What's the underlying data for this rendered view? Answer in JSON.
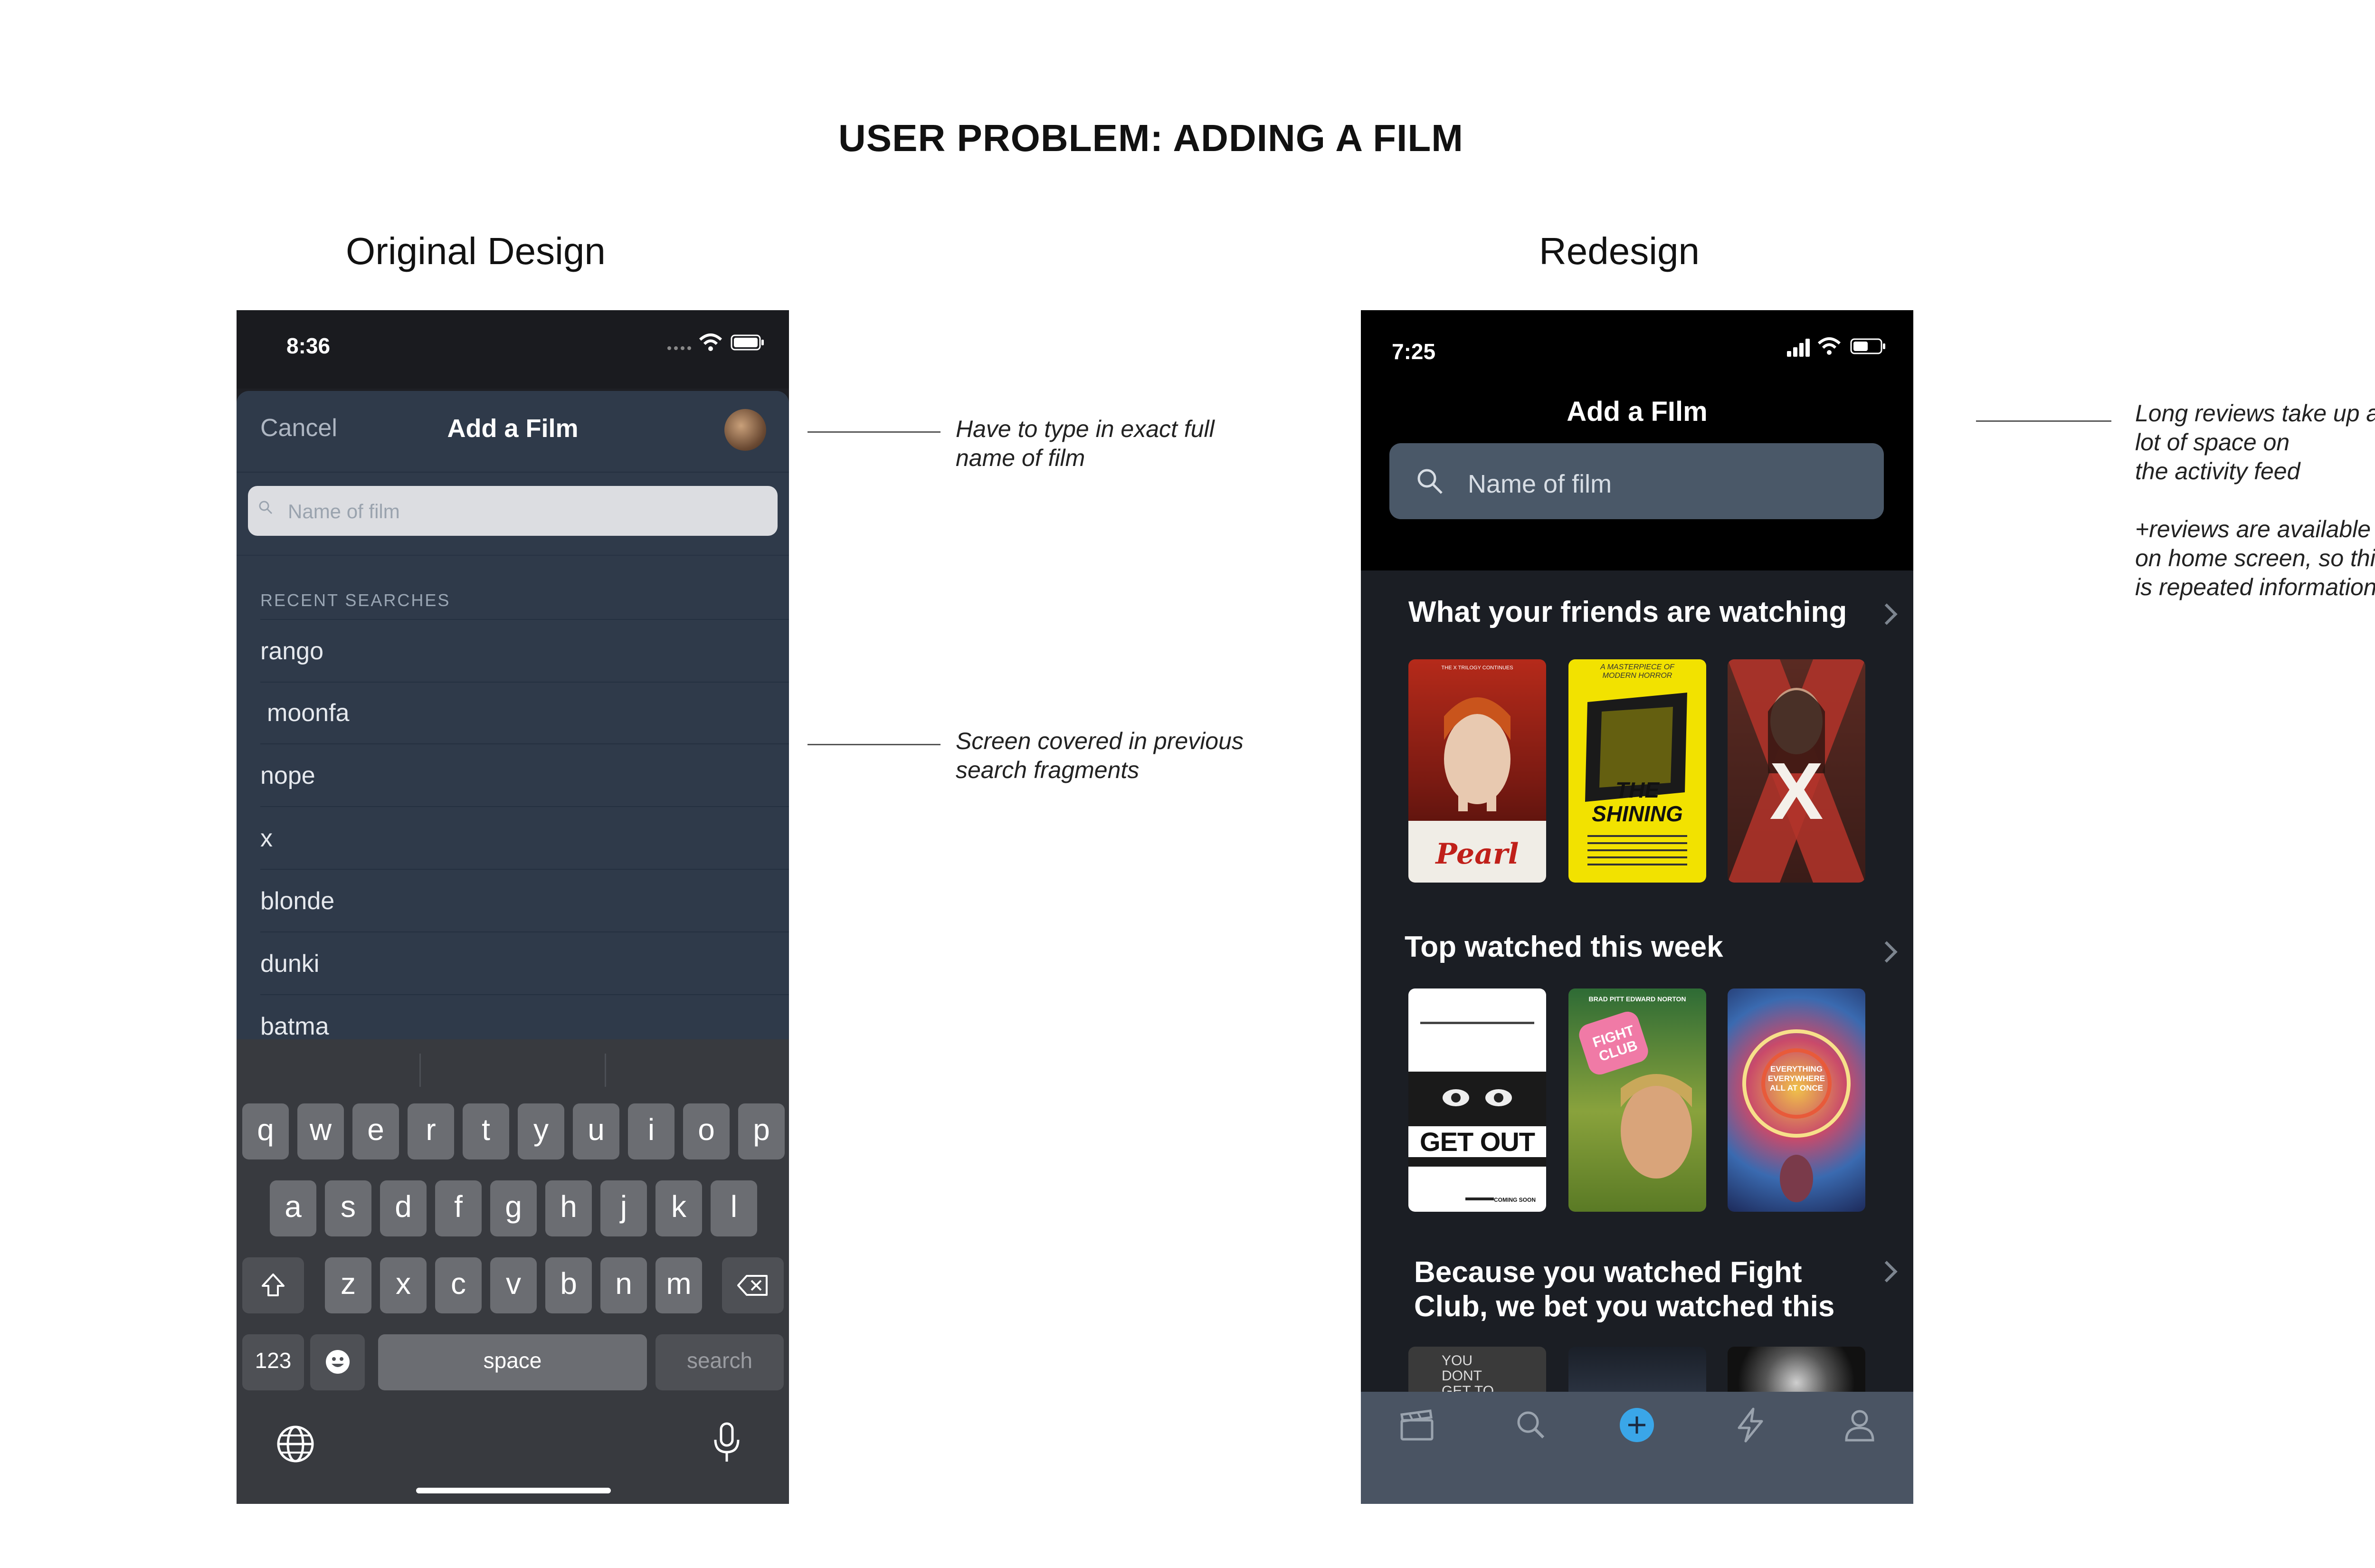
{
  "page": {
    "title": "USER PROBLEM: ADDING A FILM",
    "left_label": "Original Design",
    "right_label": "Redesign"
  },
  "annotations": {
    "original_1": "Have to type in exact full\nname of film",
    "original_2": "Screen covered in previous\nsearch fragments",
    "redesign_1": "Long reviews take up a\nlot of space on\nthe activity feed\n\n+reviews are available\non home screen, so this\nis repeated information"
  },
  "original": {
    "status_time": "8:36",
    "nav": {
      "cancel": "Cancel",
      "title": "Add a Film"
    },
    "search_placeholder": "Name of film",
    "recent_label": "RECENT SEARCHES",
    "recent": [
      "rango",
      "moonfa",
      "nope",
      "x",
      "blonde",
      "dunki",
      "batma"
    ],
    "keyboard": {
      "row1": [
        "q",
        "w",
        "e",
        "r",
        "t",
        "y",
        "u",
        "i",
        "o",
        "p"
      ],
      "row2": [
        "a",
        "s",
        "d",
        "f",
        "g",
        "h",
        "j",
        "k",
        "l"
      ],
      "row3": [
        "z",
        "x",
        "c",
        "v",
        "b",
        "n",
        "m"
      ],
      "numbers": "123",
      "space": "space",
      "search": "search"
    }
  },
  "redesign": {
    "status_time": "7:25",
    "title": "Add a FIlm",
    "search_placeholder": "Name of film",
    "sections": [
      "What your friends are watching",
      "Top watched this week",
      "Because you watched Fight\nClub, we bet you watched this"
    ],
    "posters": {
      "pearl": {
        "title": "Pearl",
        "tagline": "THE X TRILOGY CONTINUES"
      },
      "shining": {
        "title": "THE SHINING",
        "tagline": "A MASTERPIECE OF MODERN HORROR"
      },
      "x": {
        "title": "X"
      },
      "getout": {
        "title": "GET OUT",
        "tagline": "COMING SOON"
      },
      "fightclub": {
        "title": "FIGHT CLUB",
        "credits": "BRAD PITT   EDWARD NORTON"
      },
      "eeaao": {
        "title": "EVERYTHING EVERYWHERE ALL AT ONCE"
      },
      "youdont": {
        "title": "YOU DONT GET TO"
      }
    },
    "tabs": [
      "films-tab",
      "search-tab",
      "add-tab",
      "activity-tab",
      "profile-tab"
    ],
    "colors": {
      "accent": "#3aa6e8",
      "tabbar": "#4a5463",
      "search": "#4a5868"
    }
  }
}
